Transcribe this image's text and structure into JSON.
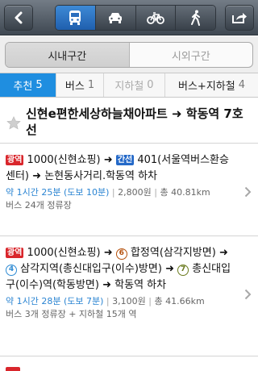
{
  "nav": {
    "back_icon": "chevron-left-icon",
    "share_icon": "share-icon",
    "modes": [
      {
        "icon": "bus-icon",
        "active": true
      },
      {
        "icon": "car-icon",
        "active": false
      },
      {
        "icon": "bicycle-icon",
        "active": false
      },
      {
        "icon": "walking-icon",
        "active": false
      }
    ],
    "active_color": "#2b78c9"
  },
  "region": {
    "tabs": [
      "시내구간",
      "시외구간"
    ],
    "selected": 0
  },
  "filters": [
    {
      "label": "추천",
      "count": "5",
      "active": true
    },
    {
      "label": "버스",
      "count": "1",
      "active": false
    },
    {
      "label": "지하철",
      "count": "0",
      "active": false,
      "disabled": true
    },
    {
      "label": "버스+지하철",
      "count": "4",
      "active": false
    }
  ],
  "favorite": {
    "title": "신현e편한세상하늘채아파트 ➜ 학동역 7호선",
    "star_icon": "star-icon"
  },
  "routes": [
    {
      "badge_wide": "광역",
      "bus_wide": "1000(신현쇼핑)",
      "badge_trunk": "간선",
      "bus_trunk": "401(서울역버스환승센터)",
      "dest": "논현동사거리.학동역 하차",
      "time": "약 1시간 25분 (도보 10분)",
      "fare": "2,800원",
      "distance": "총 40.81km",
      "summary": "버스 24개 정류장"
    },
    {
      "badge_wide": "광역",
      "bus_wide": "1000(신현쇼핑)",
      "line_a": "6",
      "station_a": "합정역",
      "station_a_dir": "(삼각지방면)",
      "line_b": "4",
      "station_b": "삼각지역",
      "station_b_dir": "(총신대입구(이수)방면)",
      "line_c": "7",
      "station_c": "총신대입구(이수)역",
      "station_c_dir": "(학동방면)",
      "dest": "학동역 하차",
      "time": "약 1시간 28분 (도보 7분)",
      "fare": "3,100원",
      "distance": "총 41.66km",
      "summary": "버스 3개 정류장 + 지하철 15개 역"
    }
  ],
  "arrow": "➜",
  "sep": "|",
  "colors": {
    "badge_red": "#d9262c",
    "badge_blue": "#2469c8",
    "time_blue": "#2a84d2",
    "line6": "#b5500b",
    "line4": "#2d8ad3",
    "line7": "#6a7a1e"
  }
}
